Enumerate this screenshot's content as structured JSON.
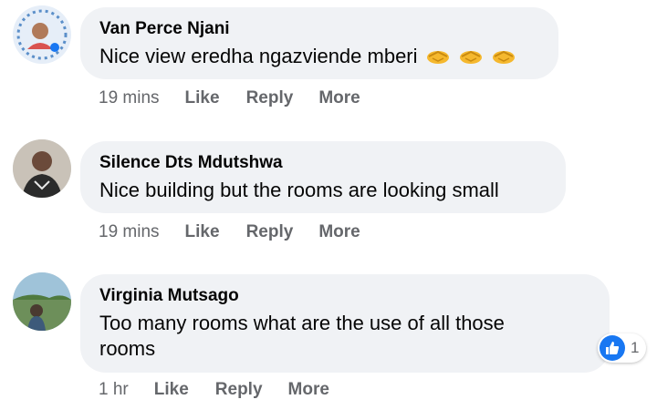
{
  "comments": [
    {
      "author": "Van Perce Njani",
      "text": "Nice view eredha ngazviende mberi",
      "emoji": [
        "handshake-icon",
        "handshake-icon",
        "handshake-icon"
      ],
      "time": "19 mins",
      "like": "Like",
      "reply": "Reply",
      "more": "More"
    },
    {
      "author": "Silence Dts Mdutshwa",
      "text": "Nice building but the rooms are looking small",
      "time": "19 mins",
      "like": "Like",
      "reply": "Reply",
      "more": "More"
    },
    {
      "author": "Virginia Mutsago",
      "text_line1": "Too many rooms what are the use of all those",
      "text_line2": "rooms",
      "time": "1 hr",
      "like": "Like",
      "reply": "Reply",
      "more": "More",
      "reaction": {
        "icon": "like-icon",
        "count": "1"
      }
    }
  ],
  "colors": {
    "bubble": "#f0f2f5",
    "secondary_text": "#65676b",
    "like_blue": "#1877f2"
  }
}
